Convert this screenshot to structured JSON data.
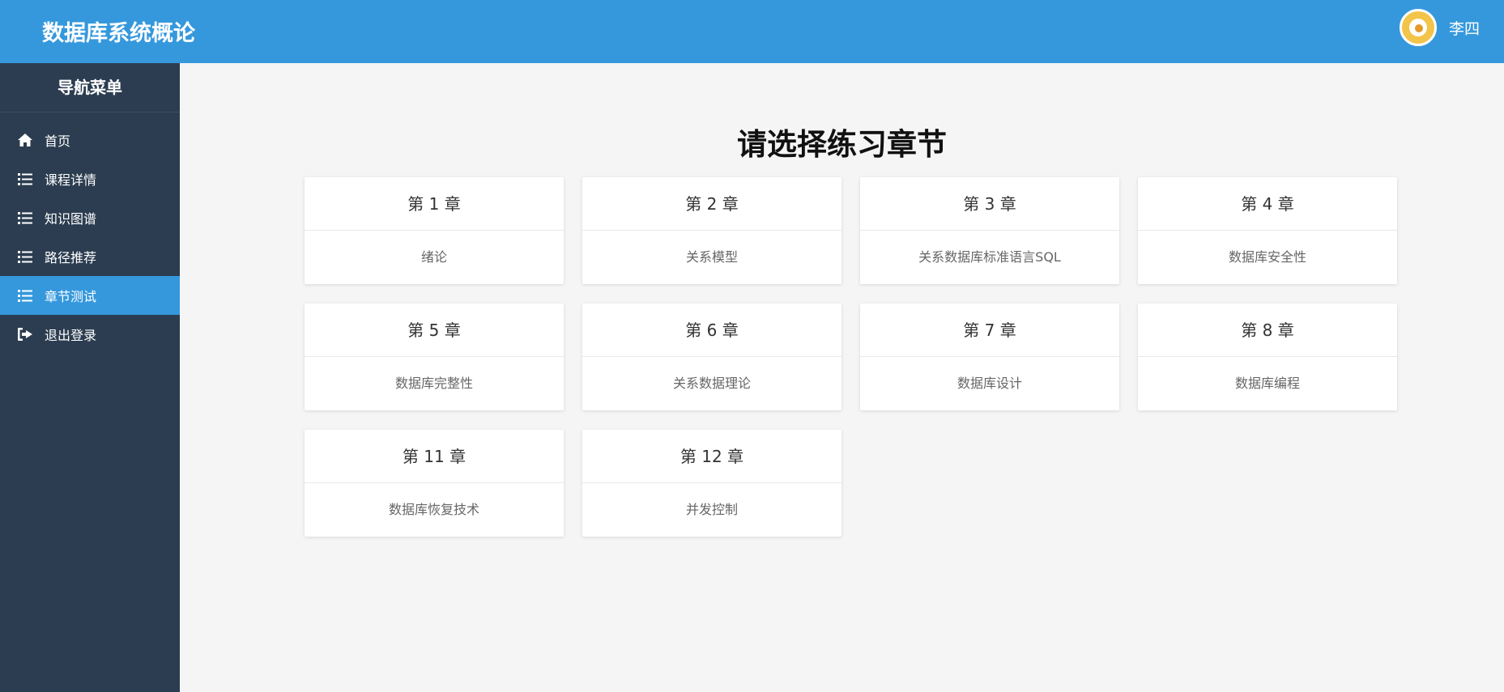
{
  "header": {
    "app_title": "数据库系统概论",
    "user_name": "李四",
    "background_color": "#3598dc"
  },
  "sidebar": {
    "title": "导航菜单",
    "background_color": "#2c3d51",
    "items": [
      {
        "label": "首页",
        "icon": "home-icon"
      },
      {
        "label": "课程详情",
        "icon": "list-icon"
      },
      {
        "label": "知识图谱",
        "icon": "list-icon"
      },
      {
        "label": "路径推荐",
        "icon": "list-icon"
      },
      {
        "label": "章节测试",
        "icon": "list-icon",
        "active": true
      },
      {
        "label": "退出登录",
        "icon": "sign-out-icon"
      }
    ]
  },
  "main": {
    "heading": "请选择练习章节",
    "chapters": [
      {
        "title": "第 1 章",
        "name": "绪论"
      },
      {
        "title": "第 2 章",
        "name": "关系模型"
      },
      {
        "title": "第 3 章",
        "name": "关系数据库标准语言SQL"
      },
      {
        "title": "第 4 章",
        "name": "数据库安全性"
      },
      {
        "title": "第 5 章",
        "name": "数据库完整性"
      },
      {
        "title": "第 6 章",
        "name": "关系数据理论"
      },
      {
        "title": "第 7 章",
        "name": "数据库设计"
      },
      {
        "title": "第 8 章",
        "name": "数据库编程"
      },
      {
        "title": "第 11 章",
        "name": "数据库恢复技术"
      },
      {
        "title": "第 12 章",
        "name": "并发控制"
      }
    ]
  }
}
